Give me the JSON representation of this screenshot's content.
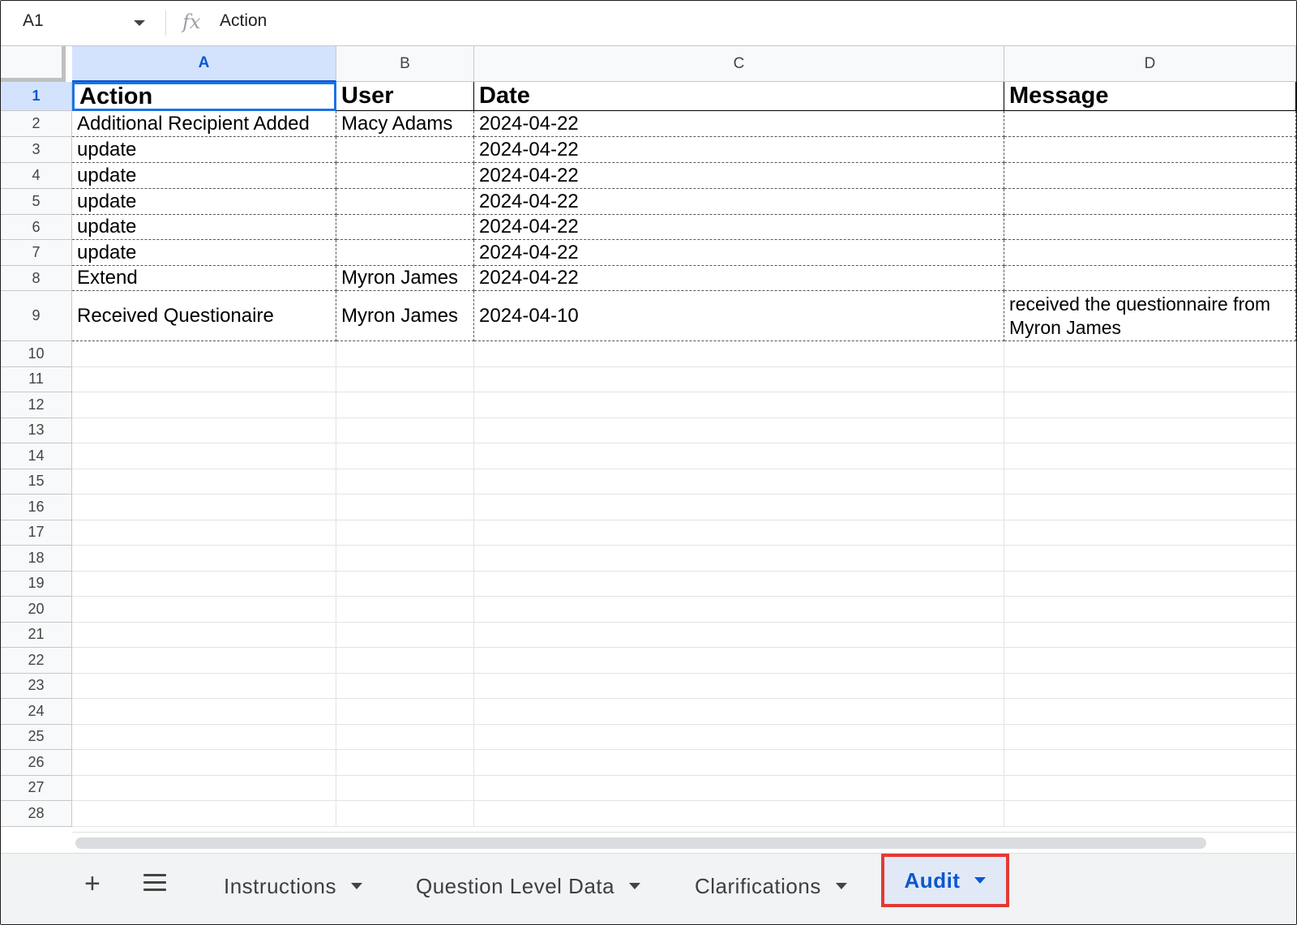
{
  "formula_bar": {
    "name_box": "A1",
    "fx_label": "fx",
    "content": "Action"
  },
  "columns": [
    "A",
    "B",
    "C",
    "D"
  ],
  "rows": [
    {
      "num": "1",
      "cells": [
        "Action",
        "User",
        "Date",
        "Message"
      ]
    },
    {
      "num": "2",
      "cells": [
        "Additional Recipient Added",
        "Macy  Adams",
        "2024-04-22",
        ""
      ]
    },
    {
      "num": "3",
      "cells": [
        "update",
        "",
        "2024-04-22",
        ""
      ]
    },
    {
      "num": "4",
      "cells": [
        "update",
        "",
        "2024-04-22",
        ""
      ]
    },
    {
      "num": "5",
      "cells": [
        "update",
        "",
        "2024-04-22",
        ""
      ]
    },
    {
      "num": "6",
      "cells": [
        "update",
        "",
        "2024-04-22",
        ""
      ]
    },
    {
      "num": "7",
      "cells": [
        "update",
        "",
        "2024-04-22",
        ""
      ]
    },
    {
      "num": "8",
      "cells": [
        "Extend",
        "Myron James",
        "2024-04-22",
        ""
      ]
    },
    {
      "num": "9",
      "cells": [
        "Received Questionaire",
        "Myron James",
        "2024-04-10",
        "received the questionnaire from Myron James"
      ]
    },
    {
      "num": "10",
      "cells": [
        "",
        "",
        "",
        ""
      ]
    },
    {
      "num": "11",
      "cells": [
        "",
        "",
        "",
        ""
      ]
    },
    {
      "num": "12",
      "cells": [
        "",
        "",
        "",
        ""
      ]
    },
    {
      "num": "13",
      "cells": [
        "",
        "",
        "",
        ""
      ]
    },
    {
      "num": "14",
      "cells": [
        "",
        "",
        "",
        ""
      ]
    },
    {
      "num": "15",
      "cells": [
        "",
        "",
        "",
        ""
      ]
    },
    {
      "num": "16",
      "cells": [
        "",
        "",
        "",
        ""
      ]
    },
    {
      "num": "17",
      "cells": [
        "",
        "",
        "",
        ""
      ]
    },
    {
      "num": "18",
      "cells": [
        "",
        "",
        "",
        ""
      ]
    },
    {
      "num": "19",
      "cells": [
        "",
        "",
        "",
        ""
      ]
    },
    {
      "num": "20",
      "cells": [
        "",
        "",
        "",
        ""
      ]
    },
    {
      "num": "21",
      "cells": [
        "",
        "",
        "",
        ""
      ]
    },
    {
      "num": "22",
      "cells": [
        "",
        "",
        "",
        ""
      ]
    },
    {
      "num": "23",
      "cells": [
        "",
        "",
        "",
        ""
      ]
    },
    {
      "num": "24",
      "cells": [
        "",
        "",
        "",
        ""
      ]
    },
    {
      "num": "25",
      "cells": [
        "",
        "",
        "",
        ""
      ]
    },
    {
      "num": "26",
      "cells": [
        "",
        "",
        "",
        ""
      ]
    },
    {
      "num": "27",
      "cells": [
        "",
        "",
        "",
        ""
      ]
    },
    {
      "num": "28",
      "cells": [
        "",
        "",
        "",
        ""
      ]
    }
  ],
  "tabs": {
    "add_icon": "+",
    "items": [
      "Instructions",
      "Question Level Data",
      "Clarifications",
      "Audit"
    ],
    "active": "Audit"
  },
  "colors": {
    "selection": "#d3e3fd",
    "active_tab_text": "#0b57d0",
    "highlight_box": "#e53935"
  }
}
